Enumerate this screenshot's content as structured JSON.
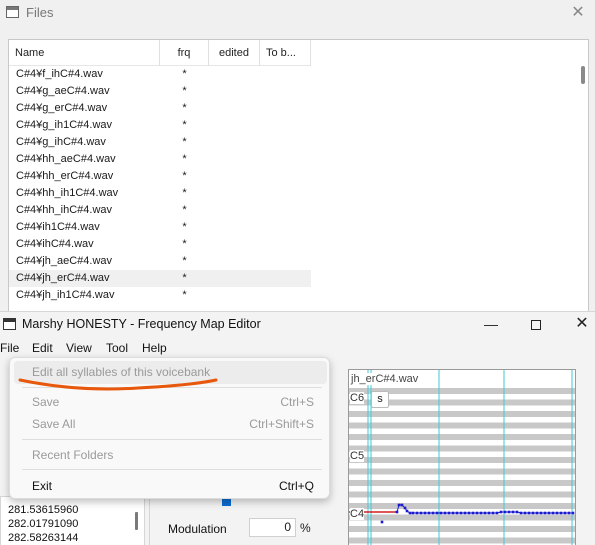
{
  "files_window": {
    "title": "Files",
    "columns": [
      "Name",
      "frq",
      "edited",
      "To b..."
    ],
    "rows": [
      {
        "name": "C#4¥f_ihC#4.wav",
        "frq": "*"
      },
      {
        "name": "C#4¥g_aeC#4.wav",
        "frq": "*"
      },
      {
        "name": "C#4¥g_erC#4.wav",
        "frq": "*"
      },
      {
        "name": "C#4¥g_ih1C#4.wav",
        "frq": "*"
      },
      {
        "name": "C#4¥g_ihC#4.wav",
        "frq": "*"
      },
      {
        "name": "C#4¥hh_aeC#4.wav",
        "frq": "*"
      },
      {
        "name": "C#4¥hh_erC#4.wav",
        "frq": "*"
      },
      {
        "name": "C#4¥hh_ih1C#4.wav",
        "frq": "*"
      },
      {
        "name": "C#4¥hh_ihC#4.wav",
        "frq": "*"
      },
      {
        "name": "C#4¥ih1C#4.wav",
        "frq": "*"
      },
      {
        "name": "C#4¥ihC#4.wav",
        "frq": "*"
      },
      {
        "name": "C#4¥jh_aeC#4.wav",
        "frq": "*"
      },
      {
        "name": "C#4¥jh_erC#4.wav",
        "frq": "*",
        "selected": true
      },
      {
        "name": "C#4¥jh_ih1C#4.wav",
        "frq": "*"
      }
    ],
    "close_glyph": "✕"
  },
  "editor_window": {
    "title": "Marshy HONESTY - Frequency Map Editor",
    "controls": {
      "minimize": "—",
      "close": "✕"
    },
    "menu": [
      "File",
      "Edit",
      "View",
      "Tool",
      "Help"
    ],
    "value_list": [
      "281.53615960",
      "282.01791090",
      "282.58263144"
    ],
    "modulation_label": "Modulation",
    "modulation_value": "0",
    "modulation_unit": "%",
    "graph": {
      "file_label": "jh_erC#4.wav",
      "notes": [
        "C6",
        "C5",
        "C4"
      ],
      "s_button": "s",
      "pitch_line_color": "#1a1ad0",
      "reference_line_color": "#d02020"
    }
  },
  "file_menu": {
    "items": [
      {
        "label": "Edit all syllables of this voicebank",
        "shortcut": "",
        "enabled": false
      },
      {
        "label": "Save",
        "shortcut": "Ctrl+S",
        "enabled": false
      },
      {
        "label": "Save All",
        "shortcut": "Ctrl+Shift+S",
        "enabled": false
      },
      {
        "label": "Recent Folders",
        "shortcut": "",
        "enabled": false
      },
      {
        "label": "Exit",
        "shortcut": "Ctrl+Q",
        "enabled": true
      }
    ]
  },
  "annotation_color": "#e8580c"
}
